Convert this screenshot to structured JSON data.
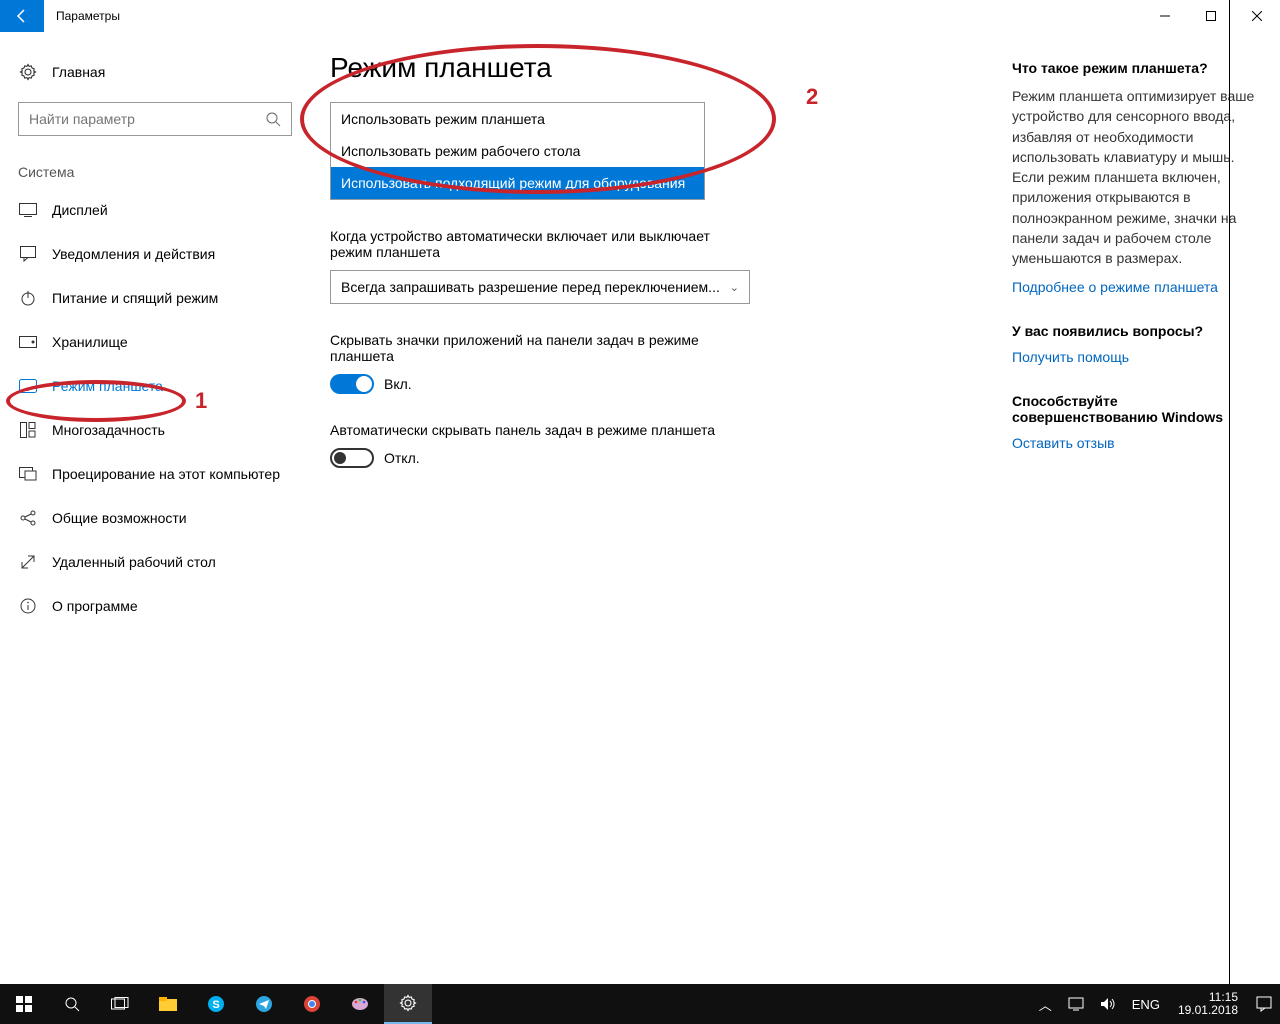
{
  "titlebar": {
    "title": "Параметры"
  },
  "sidebar": {
    "home": "Главная",
    "search_placeholder": "Найти параметр",
    "section": "Система",
    "items": [
      {
        "icon": "display",
        "label": "Дисплей"
      },
      {
        "icon": "notify",
        "label": "Уведомления и действия"
      },
      {
        "icon": "power",
        "label": "Питание и спящий режим"
      },
      {
        "icon": "storage",
        "label": "Хранилище"
      },
      {
        "icon": "tablet",
        "label": "Режим планшета"
      },
      {
        "icon": "multitask",
        "label": "Многозадачность"
      },
      {
        "icon": "project",
        "label": "Проецирование на этот компьютер"
      },
      {
        "icon": "shared",
        "label": "Общие возможности"
      },
      {
        "icon": "remote",
        "label": "Удаленный рабочий стол"
      },
      {
        "icon": "about",
        "label": "О программе"
      }
    ]
  },
  "main": {
    "heading": "Режим планшета",
    "dropdown_options": [
      "Использовать режим планшета",
      "Использовать режим рабочего стола",
      "Использовать подходящий режим для оборудования"
    ],
    "q2_label": "Когда устройство автоматически включает или выключает режим планшета",
    "q2_value": "Всегда запрашивать разрешение перед переключением...",
    "t1_label": "Скрывать значки приложений на панели задач в режиме планшета",
    "t1_state": "Вкл.",
    "t2_label": "Автоматически скрывать панель задач в режиме планшета",
    "t2_state": "Откл."
  },
  "right": {
    "h1": "Что такое режим планшета?",
    "p1": "Режим планшета оптимизирует ваше устройство для сенсорного ввода, избавляя от необходимости использовать клавиатуру и мышь. Если режим планшета включен, приложения открываются в полноэкранном режиме, значки на панели задач и рабочем столе уменьшаются в размерах.",
    "link1": "Подробнее о режиме планшета",
    "h2": "У вас появились вопросы?",
    "link2": "Получить помощь",
    "h3": "Способствуйте совершенствованию Windows",
    "link3": "Оставить отзыв"
  },
  "taskbar": {
    "lang": "ENG",
    "time": "11:15",
    "date": "19.01.2018"
  },
  "annotations": {
    "one": "1",
    "two": "2"
  }
}
